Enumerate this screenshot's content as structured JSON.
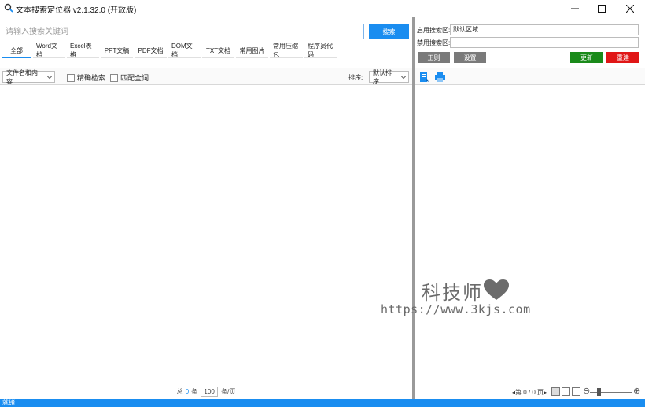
{
  "window": {
    "title": "文本搜索定位器 v2.1.32.0 (开放版)",
    "icon": "search-app-icon"
  },
  "search": {
    "placeholder": "请输入搜索关键词",
    "value": "",
    "button_label": "搜索"
  },
  "tabs": [
    {
      "label": "全部",
      "active": true
    },
    {
      "label": "Word文档",
      "active": false
    },
    {
      "label": "Excel表格",
      "active": false
    },
    {
      "label": "PPT文稿",
      "active": false
    },
    {
      "label": "PDF文档",
      "active": false
    },
    {
      "label": "DOM文档",
      "active": false
    },
    {
      "label": "TXT文档",
      "active": false
    },
    {
      "label": "常用图片",
      "active": false
    },
    {
      "label": "常用压缩包",
      "active": false
    },
    {
      "label": "程序员代码",
      "active": false
    }
  ],
  "filter": {
    "scope_selected": "文件名和内容",
    "exact_search_label": "精确检索",
    "match_word_label": "匹配全词",
    "sort_label": "排序:",
    "sort_selected": "默认排序"
  },
  "pager": {
    "total_prefix": "总",
    "total_count": "0",
    "total_suffix": "条",
    "page_size": "100",
    "page_size_suffix": "条/页"
  },
  "right": {
    "enabled_area_label": "启用搜索区:",
    "enabled_area_value": "默认区域",
    "disabled_area_label": "禁用搜索区:",
    "disabled_area_value": "",
    "regex_label": "正则",
    "settings_label": "设置",
    "update_label": "更新",
    "reset_label": "重建",
    "page_indicator": "第 0 / 0 页",
    "prev_arrow": "◂",
    "next_arrow": "▸"
  },
  "watermark": {
    "title": "科技师",
    "url": "https://www.3kjs.com"
  },
  "status": {
    "text": "就绪"
  },
  "colors": {
    "accent": "#1a8df0",
    "update": "#1a8a1a",
    "reset": "#e01616",
    "neutral_button": "#7a7a7a"
  }
}
